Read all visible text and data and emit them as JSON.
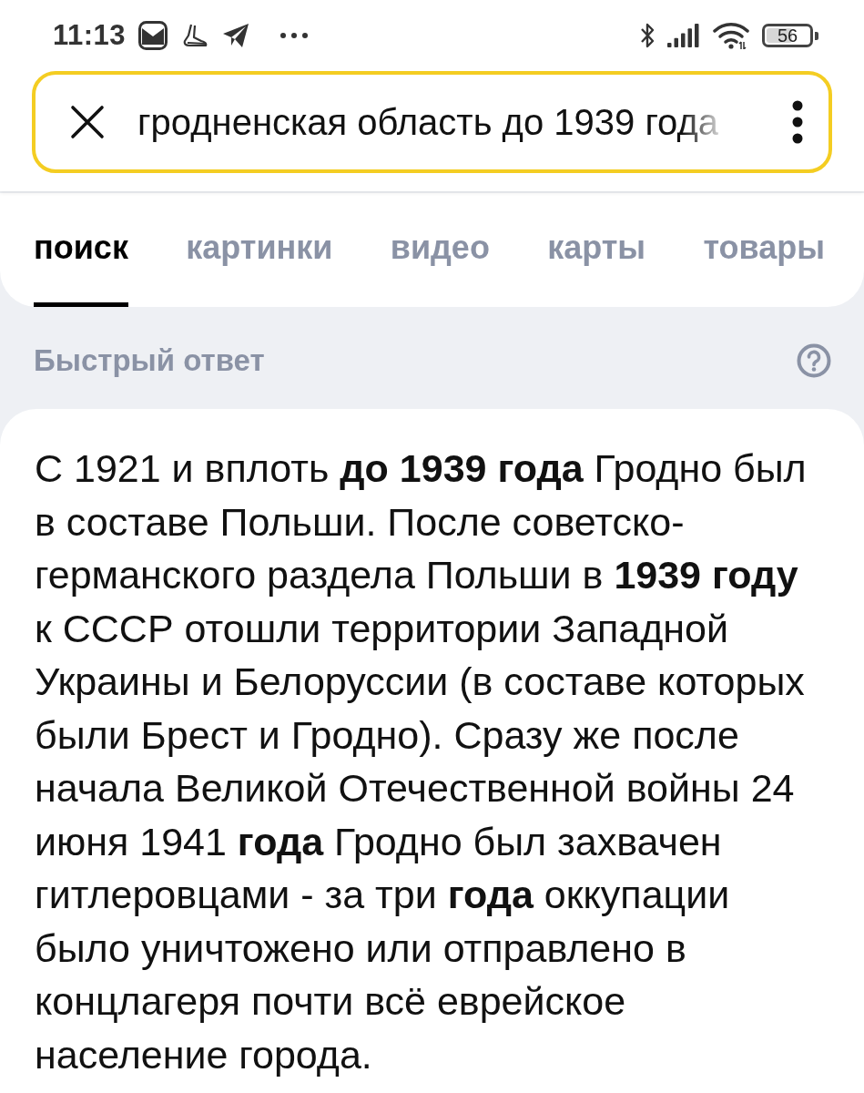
{
  "status_bar": {
    "time": "11:13",
    "battery": "56"
  },
  "search": {
    "query": "гродненская область до 1939 года"
  },
  "tabs": [
    {
      "label": "поиск",
      "selected": true
    },
    {
      "label": "картинки",
      "selected": false
    },
    {
      "label": "видео",
      "selected": false
    },
    {
      "label": "карты",
      "selected": false
    },
    {
      "label": "товары",
      "selected": false
    }
  ],
  "quick_answer": {
    "title": "Быстрый ответ",
    "text": "С 1921 и вплоть **до 1939 года** Гродно был в составе Польши. После советско-германского раздела Польши в **1939 году** к СССР отошли территории Западной Украины и Белоруссии (в составе которых были Брест и Гродно). Сразу же после начала Великой Отечественной войны 24 июня 1941 **года** Гродно был захвачен гитлеровцами - за три **года** оккупации было уничтожено или отправлено в концлагеря почти всё еврейское население города."
  }
}
